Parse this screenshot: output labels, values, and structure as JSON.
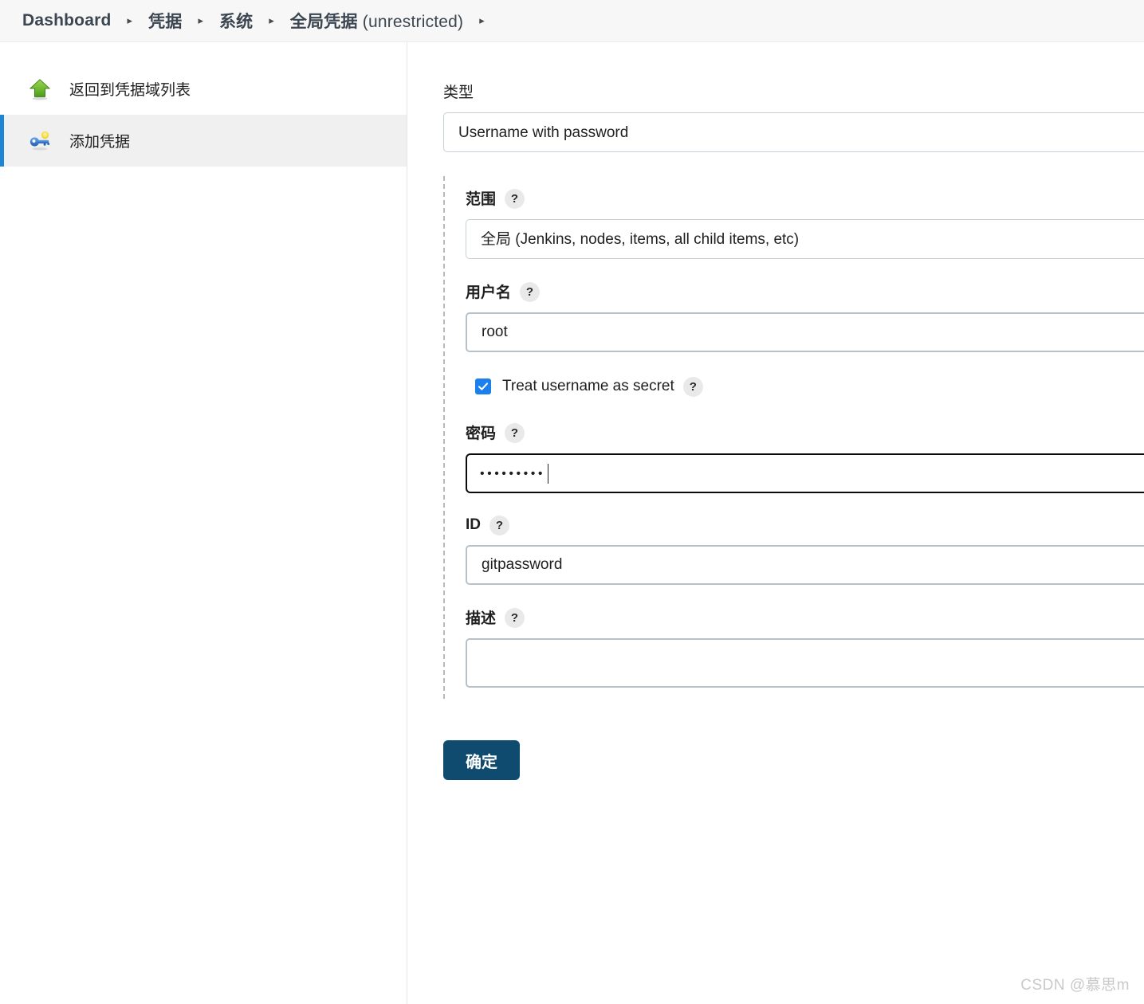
{
  "breadcrumb": {
    "separator": "▸",
    "items": [
      {
        "label": "Dashboard"
      },
      {
        "label": "凭据"
      },
      {
        "label": "系统"
      },
      {
        "label": "全局凭据 ",
        "suffix": "(unrestricted)"
      }
    ]
  },
  "sidebar": {
    "items": [
      {
        "label": "返回到凭据域列表",
        "icon": "up-arrow-icon",
        "active": false
      },
      {
        "label": "添加凭据",
        "icon": "key-icon",
        "active": true
      }
    ]
  },
  "main": {
    "type": {
      "label": "类型",
      "value": "Username with password",
      "options": [
        "Username with password"
      ]
    },
    "scope": {
      "label": "范围",
      "help": "?",
      "value": "全局 (Jenkins, nodes, items, all child items, etc)",
      "options": [
        "全局 (Jenkins, nodes, items, all child items, etc)"
      ]
    },
    "username": {
      "label": "用户名",
      "help": "?",
      "value": "root",
      "placeholder": ""
    },
    "treat_as_secret": {
      "label": "Treat username as secret",
      "help": "?",
      "checked": true
    },
    "password": {
      "label": "密码",
      "help": "?",
      "masked_value": "•••••••••",
      "focused": true
    },
    "id": {
      "label": "ID",
      "help": "?",
      "value": "gitpassword",
      "placeholder": ""
    },
    "description": {
      "label": "描述",
      "help": "?",
      "value": "",
      "placeholder": ""
    },
    "submit": {
      "label": "确定"
    }
  },
  "watermark": {
    "text": "CSDN @慕思m"
  },
  "colors": {
    "accent_blue": "#1c86d4",
    "button_navy": "#0e4b6e",
    "checkbox_blue": "#1b7fed",
    "breadcrumb_bg": "#f7f7f7",
    "sidebar_active_bg": "#f0f0f0"
  }
}
